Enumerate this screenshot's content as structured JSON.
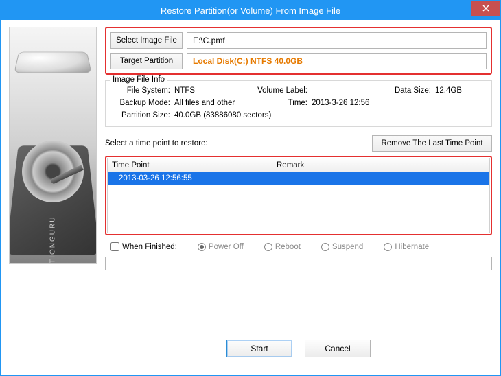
{
  "titlebar": {
    "title": "Restore Partition(or Volume) From Image File"
  },
  "buttons": {
    "select_image": "Select Image File",
    "target_partition": "Target Partition",
    "remove_last": "Remove The Last Time Point",
    "start": "Start",
    "cancel": "Cancel"
  },
  "fields": {
    "image_path": "E:\\C.pmf",
    "target_partition": "Local Disk(C:) NTFS 40.0GB"
  },
  "info": {
    "group_title": "Image File Info",
    "fs_label": "File System:",
    "fs_value": "NTFS",
    "vol_label": "Volume Label:",
    "vol_value": "",
    "ds_label": "Data Size:",
    "ds_value": "12.4GB",
    "bm_label": "Backup Mode:",
    "bm_value": "All files and other",
    "time_label": "Time:",
    "time_value": "2013-3-26 12:56",
    "ps_label": "Partition Size:",
    "ps_value": "40.0GB  (83886080 sectors)"
  },
  "restore": {
    "label": "Select a time point to restore:",
    "col_tp": "Time Point",
    "col_rm": "Remark"
  },
  "timepoints": [
    {
      "time": "2013-03-26 12:56:55",
      "remark": ""
    }
  ],
  "whenfin": {
    "label": "When Finished:",
    "poweroff": "Power Off",
    "reboot": "Reboot",
    "suspend": "Suspend",
    "hibernate": "Hibernate"
  },
  "sidebar": {
    "brand": "PARTITIONGURU"
  }
}
